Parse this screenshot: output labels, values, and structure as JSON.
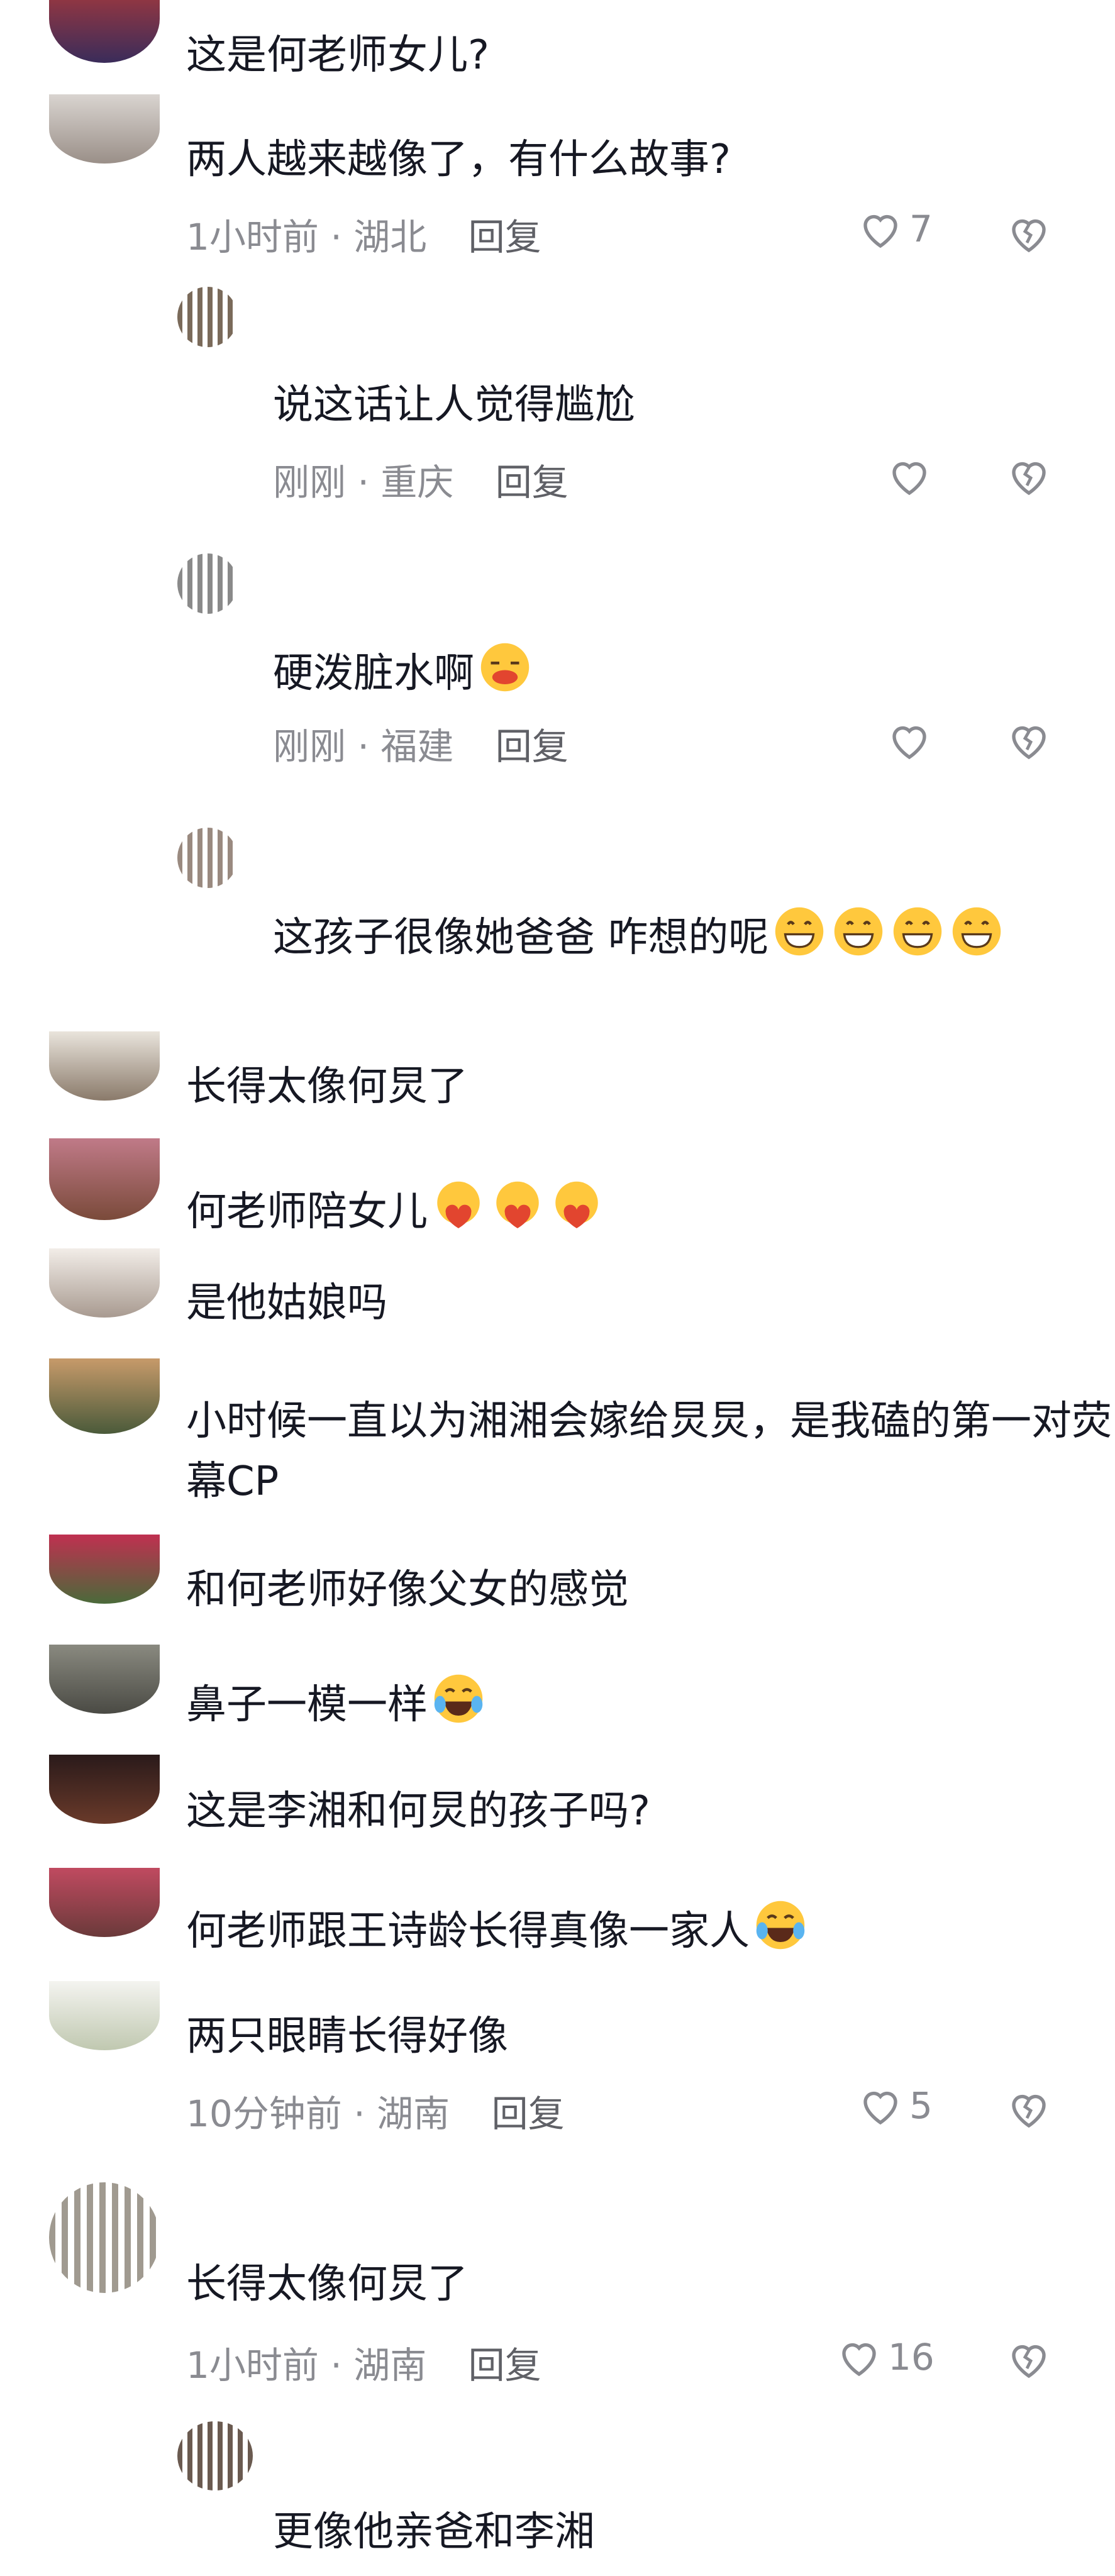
{
  "colors": {
    "text": "#161823",
    "meta": "#8a8b91",
    "reply": "#5f6066",
    "icon": "#8a8b91"
  },
  "icons": {
    "like": "heart-outline-icon",
    "dislike": "broken-heart-icon"
  },
  "comments": [
    {
      "text": "这是何老师女儿?"
    },
    {
      "text": "两人越来越像了，有什么故事?",
      "time": "1小时前",
      "location": "湖北",
      "reply": "回复",
      "likes": "7"
    },
    {
      "text": "说这话让人觉得尴尬",
      "time": "刚刚",
      "location": "重庆",
      "reply": "回复"
    },
    {
      "text": "硬泼脏水啊",
      "time": "刚刚",
      "location": "福建",
      "reply": "回复"
    },
    {
      "text": "这孩子很像她爸爸  咋想的呢"
    },
    {
      "text": "长得太像何炅了"
    },
    {
      "text": "何老师陪女儿"
    },
    {
      "text": "是他姑娘吗"
    },
    {
      "text": "小时候一直以为湘湘会嫁给炅炅，是我磕的第一对荧幕CP"
    },
    {
      "text": "和何老师好像父女的感觉"
    },
    {
      "text": "鼻子一模一样"
    },
    {
      "text": "这是李湘和何炅的孩子吗?"
    },
    {
      "text": "何老师跟王诗龄长得真像一家人"
    },
    {
      "text": "两只眼睛长得好像",
      "time": "10分钟前",
      "location": "湖南",
      "reply": "回复",
      "likes": "5"
    },
    {
      "text": "长得太像何炅了",
      "time": "1小时前",
      "location": "湖南",
      "reply": "回复",
      "likes": "16"
    },
    {
      "text": "更像他亲爸和李湘"
    }
  ]
}
